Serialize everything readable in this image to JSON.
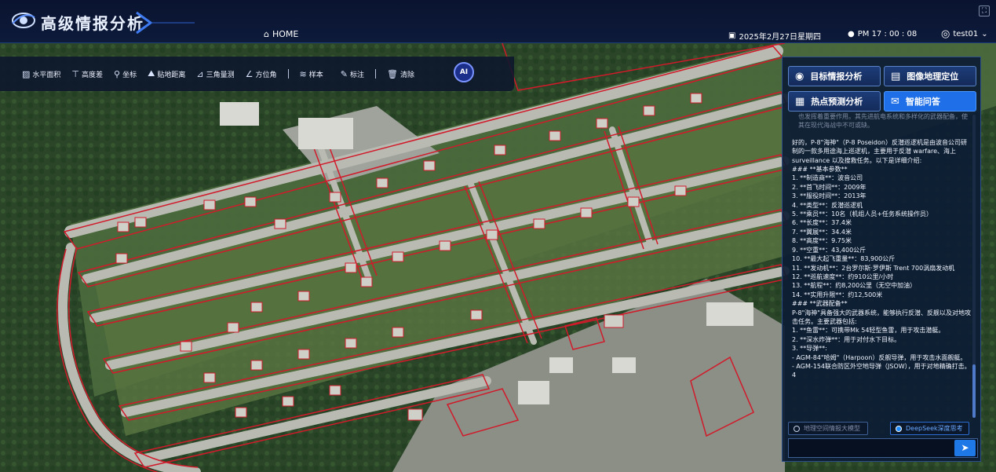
{
  "app": {
    "title": "高级情报分析"
  },
  "header": {
    "home_label": "HOME",
    "date": "2025年2月27日星期四",
    "time": "PM 17 : 00 : 08",
    "user": "test01"
  },
  "toolbar": {
    "tools": [
      {
        "label": "水平面积",
        "icon": "area-icon"
      },
      {
        "label": "高度差",
        "icon": "height-icon"
      },
      {
        "label": "坐标",
        "icon": "pin-icon"
      },
      {
        "label": "贴地距离",
        "icon": "ground-distance-icon"
      },
      {
        "label": "三角量测",
        "icon": "triangle-icon"
      },
      {
        "label": "方位角",
        "icon": "angle-icon"
      },
      {
        "label": "样本",
        "icon": "layers-icon"
      },
      {
        "label": "标注",
        "icon": "pen-icon"
      },
      {
        "label": "清除",
        "icon": "trash-icon"
      }
    ],
    "ai_label": "AI"
  },
  "panel": {
    "buttons": [
      {
        "label": "目标情报分析",
        "icon": "target-icon"
      },
      {
        "label": "图像地理定位",
        "icon": "map-icon"
      },
      {
        "label": "热点预测分析",
        "icon": "report-icon"
      },
      {
        "label": "智能问答",
        "icon": "chat-icon",
        "active": true
      }
    ],
    "faded_text": "也发挥着重要作用。其先进航电系统和多样化的武器配备，使其在现代海战中不可或缺。",
    "lines": [
      "好的，P-8\"海神\"（P-8 Poseidon）反潜巡逻机是由波音公司研制的一款多用途海上巡逻机，主要用于反潜 warfare、海上 surveillance 以及搜救任务。以下是详细介绍:",
      "### **基本参数**",
      "1. **制造商**：波音公司",
      "2. **首飞时间**：2009年",
      "3. **服役时间**：2013年",
      "4. **类型**：反潜巡逻机",
      "5. **乘员**：10名（机组人员+任务系统操作员）",
      "6. **长度**：37.4米",
      "7. **翼展**：34.4米",
      "8. **高度**：9.75米",
      "9. **空重**：43,400公斤",
      "10. **最大起飞重量**：83,900公斤",
      "11. **发动机**：2台罗尔斯·罗伊斯 Trent 700涡扇发动机",
      "12. **巡航速度**：约910公里/小时",
      "13. **航程**：约8,200公里（无空中加油）",
      "14. **实用升限**：约12,500米",
      "### **武器配备**",
      "P-8\"海神\"具备强大的武器系统，能够执行反潜、反舰以及对地攻击任务。主要武器包括:",
      "1. **鱼雷**：可携带Mk 54轻型鱼雷，用于攻击潜艇。",
      "2. **深水炸弹**：用于对付水下目标。",
      "3. **导弹**:",
      "- AGM-84\"哈姆\"（Harpoon）反舰导弹，用于攻击水面舰艇。",
      "- AGM-154联合防区外空地导弹（JSOW），用于对地精确打击。",
      "4"
    ],
    "model_options": [
      {
        "label": "地理空间情报大模型",
        "selected": false
      },
      {
        "label": "DeepSeek深度思考",
        "selected": true
      }
    ],
    "input_placeholder": ""
  },
  "colors": {
    "accent": "#1e6fe8",
    "header_bg": "#0a1430",
    "annotation": "#d11a2a"
  }
}
